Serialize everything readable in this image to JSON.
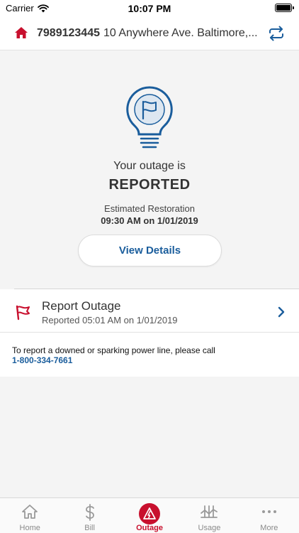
{
  "status_bar": {
    "carrier": "Carrier",
    "time": "10:07 PM"
  },
  "account": {
    "number": "7989123445",
    "address": "10 Anywhere Ave. Baltimore,..."
  },
  "outage": {
    "status_prefix": "Your outage is",
    "status": "REPORTED",
    "estimated_label": "Estimated Restoration",
    "estimated_value": "09:30 AM on 1/01/2019",
    "view_details_label": "View Details"
  },
  "report": {
    "title": "Report Outage",
    "subtitle": "Reported 05:01 AM on 1/01/2019"
  },
  "notice": {
    "message": "To report a downed or sparking power line, please call",
    "phone": "1-800-334-7661"
  },
  "tabs": [
    {
      "label": "Home",
      "icon": "home-icon"
    },
    {
      "label": "Bill",
      "icon": "dollar-icon"
    },
    {
      "label": "Outage",
      "icon": "outage-icon",
      "active": true
    },
    {
      "label": "Usage",
      "icon": "usage-icon"
    },
    {
      "label": "More",
      "icon": "more-icon"
    }
  ],
  "colors": {
    "brand_red": "#c8102e",
    "link_blue": "#1a5d9c"
  }
}
